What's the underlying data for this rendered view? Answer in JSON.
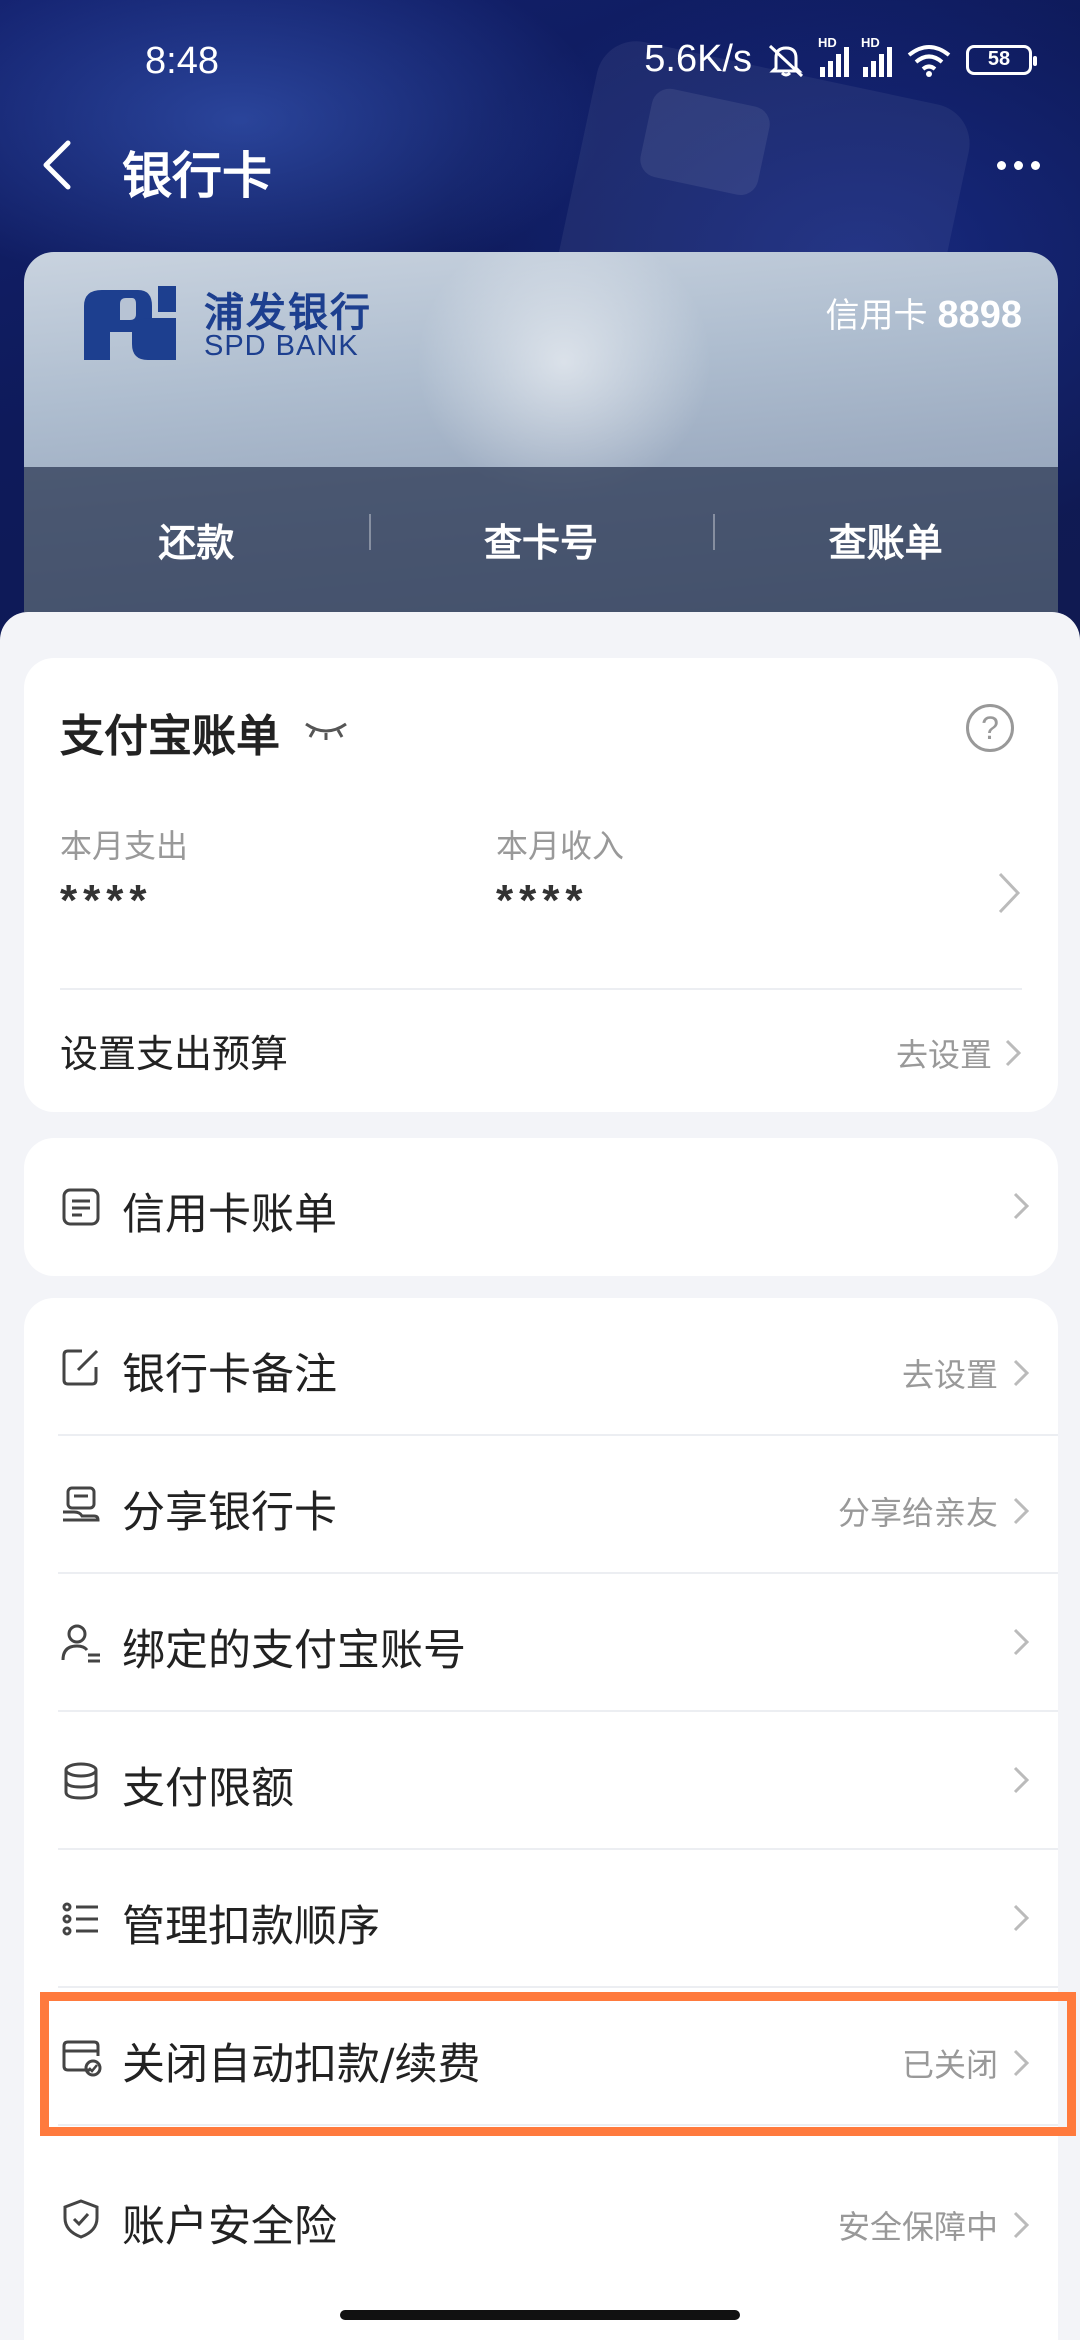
{
  "status_bar": {
    "time": "8:48",
    "net_speed": "5.6K/s",
    "battery": "58",
    "hd_label": "HD"
  },
  "nav": {
    "title": "银行卡"
  },
  "card": {
    "bank_name": "浦发银行",
    "bank_name_en": "SPD BANK",
    "card_type": "信用卡",
    "card_last4": "8898",
    "actions": [
      "还款",
      "查卡号",
      "查账单"
    ]
  },
  "bill": {
    "title": "支付宝账单",
    "help": "?",
    "expense_label": "本月支出",
    "expense_value": "****",
    "income_label": "本月收入",
    "income_value": "****",
    "budget_label": "设置支出预算",
    "budget_action": "去设置"
  },
  "credit_bill": {
    "label": "信用卡账单"
  },
  "menu": {
    "items": [
      {
        "label": "银行卡备注",
        "right": "去设置",
        "icon": "edit-icon"
      },
      {
        "label": "分享银行卡",
        "right": "分享给亲友",
        "icon": "share-card-icon"
      },
      {
        "label": "绑定的支付宝账号",
        "right": "",
        "icon": "user-lines-icon"
      },
      {
        "label": "支付限额",
        "right": "",
        "icon": "database-icon"
      },
      {
        "label": "管理扣款顺序",
        "right": "",
        "icon": "list-icon"
      },
      {
        "label": "关闭自动扣款/续费",
        "right": "已关闭",
        "icon": "card-check-icon"
      },
      {
        "label": "账户安全险",
        "right": "安全保障中",
        "icon": "shield-check-icon"
      }
    ]
  },
  "colors": {
    "header_blue": "#13216e",
    "bank_blue": "#1d3f8f",
    "highlight": "#ff7a3d",
    "muted": "#999999"
  }
}
